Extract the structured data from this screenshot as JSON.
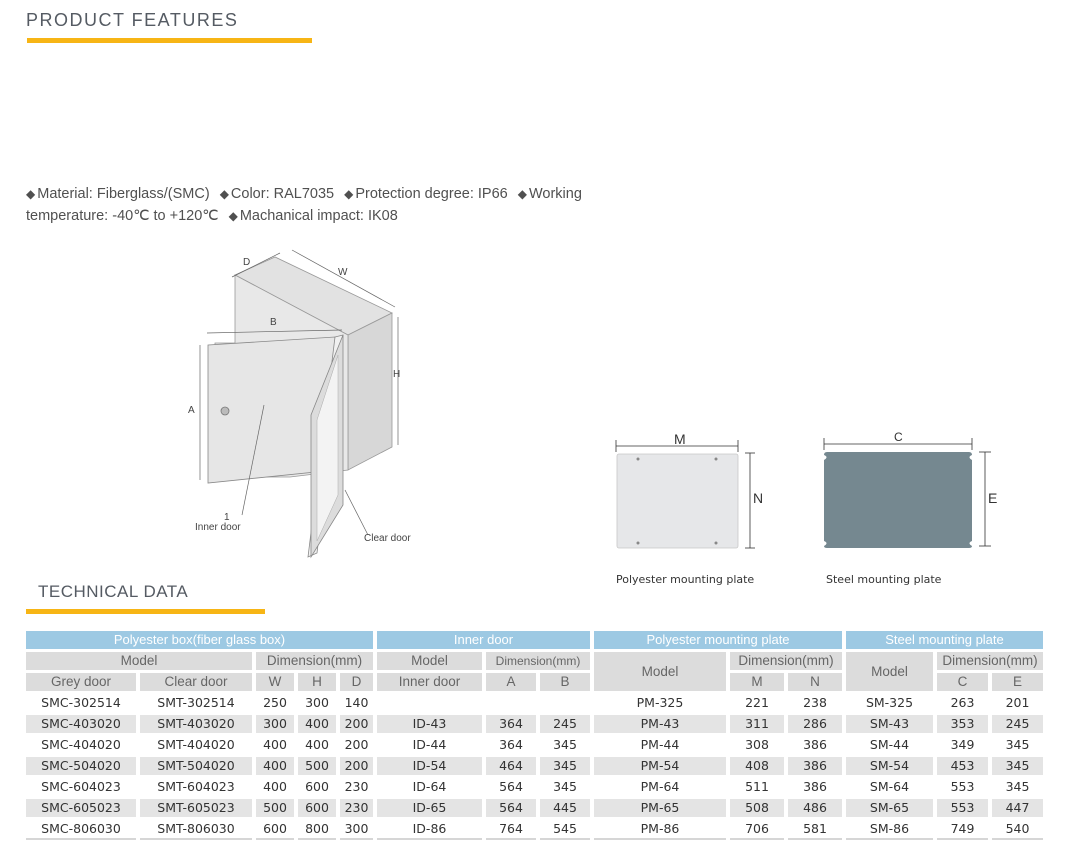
{
  "product_features": {
    "title": "PRODUCT FEATURES",
    "items": [
      "Material: Fiberglass/(SMC)",
      "Color: RAL7035",
      "Protection degree: IP66",
      "Working temperature: -40℃ to +120℃",
      "Machanical impact: IK08"
    ],
    "bullet": "◆"
  },
  "diagram": {
    "labels": {
      "D": "D",
      "W": "W",
      "H": "H",
      "A": "A",
      "B": "B",
      "inner_door": "Inner door",
      "clear_door": "Clear door",
      "ref": "1"
    }
  },
  "plates": {
    "polyester": {
      "caption": "Polyester mounting plate",
      "dim_x": "M",
      "dim_y": "N",
      "color": "#e6e7e9"
    },
    "steel": {
      "caption": "Steel mounting plate",
      "dim_x": "C",
      "dim_y": "E",
      "color": "#758890"
    }
  },
  "technical_data": {
    "title": "TECHNICAL DATA",
    "groups": [
      "Polyester box(fiber glass box)",
      "Inner door",
      "Polyester mounting plate",
      "Steel mounting plate"
    ],
    "sub": {
      "model": "Model",
      "dimension": "Dimension(mm)",
      "grey_door": "Grey door",
      "clear_door": "Clear door",
      "W": "W",
      "H": "H",
      "D": "D",
      "inner_door": "Inner door",
      "A": "A",
      "B": "B",
      "M": "M",
      "N": "N",
      "C": "C",
      "E": "E"
    },
    "rows": [
      [
        "SMC-302514",
        "SMT-302514",
        "250",
        "300",
        "140",
        "",
        "",
        "",
        "PM-325",
        "221",
        "238",
        "SM-325",
        "263",
        "201"
      ],
      [
        "SMC-403020",
        "SMT-403020",
        "300",
        "400",
        "200",
        "ID-43",
        "364",
        "245",
        "PM-43",
        "311",
        "286",
        "SM-43",
        "353",
        "245"
      ],
      [
        "SMC-404020",
        "SMT-404020",
        "400",
        "400",
        "200",
        "ID-44",
        "364",
        "345",
        "PM-44",
        "308",
        "386",
        "SM-44",
        "349",
        "345"
      ],
      [
        "SMC-504020",
        "SMT-504020",
        "400",
        "500",
        "200",
        "ID-54",
        "464",
        "345",
        "PM-54",
        "408",
        "386",
        "SM-54",
        "453",
        "345"
      ],
      [
        "SMC-604023",
        "SMT-604023",
        "400",
        "600",
        "230",
        "ID-64",
        "564",
        "345",
        "PM-64",
        "511",
        "386",
        "SM-64",
        "553",
        "345"
      ],
      [
        "SMC-605023",
        "SMT-605023",
        "500",
        "600",
        "230",
        "ID-65",
        "564",
        "445",
        "PM-65",
        "508",
        "486",
        "SM-65",
        "553",
        "447"
      ],
      [
        "SMC-806030",
        "SMT-806030",
        "600",
        "800",
        "300",
        "ID-86",
        "764",
        "545",
        "PM-86",
        "706",
        "581",
        "SM-86",
        "749",
        "540"
      ]
    ]
  }
}
